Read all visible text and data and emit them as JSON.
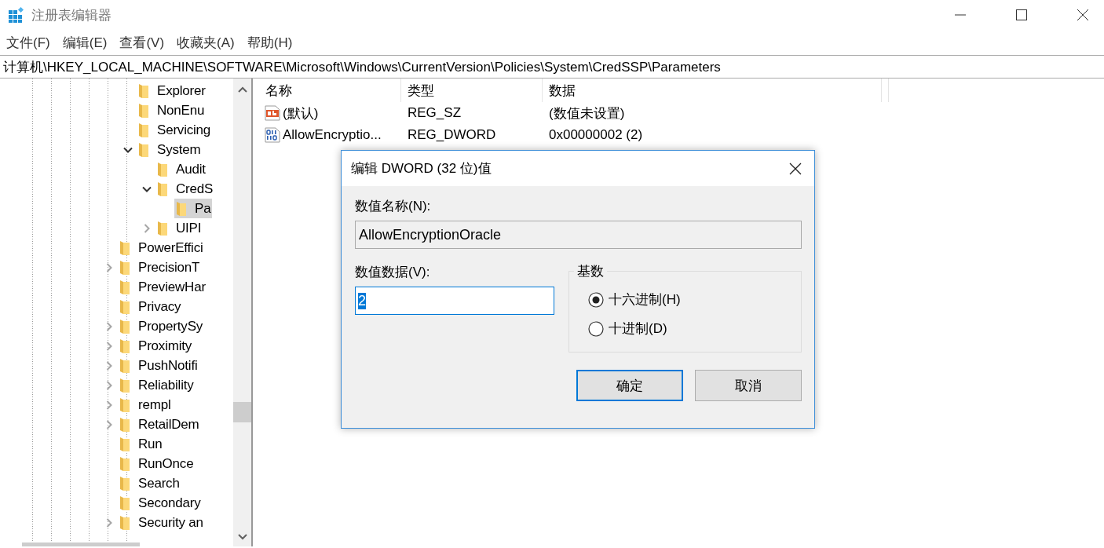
{
  "window": {
    "title": "注册表编辑器"
  },
  "menu": [
    "文件(F)",
    "编辑(E)",
    "查看(V)",
    "收藏夹(A)",
    "帮助(H)"
  ],
  "address": "计算机\\HKEY_LOCAL_MACHINE\\SOFTWARE\\Microsoft\\Windows\\CurrentVersion\\Policies\\System\\CredSSP\\Parameters",
  "tree": [
    {
      "children": [
        {
          "label": "Explorer",
          "selected": false
        },
        {
          "label": "NonEnu",
          "selected": false
        },
        {
          "label": "Servicing",
          "selected": false
        },
        {
          "label": "System",
          "expanded": true,
          "selected": false,
          "children": [
            {
              "label": "Audit",
              "selected": false
            },
            {
              "label": "CredS",
              "expanded": true,
              "selected": false,
              "children": [
                {
                  "label": "Pa",
                  "selected": true
                }
              ]
            },
            {
              "label": "UIPI",
              "expanded": false,
              "selected": false
            }
          ]
        }
      ]
    },
    {
      "label": "PowerEffici",
      "selected": false
    },
    {
      "label": "PrecisionT",
      "expanded": false,
      "selected": false
    },
    {
      "label": "PreviewHar",
      "selected": false
    },
    {
      "label": "Privacy",
      "selected": false
    },
    {
      "label": "PropertySy",
      "expanded": false,
      "selected": false
    },
    {
      "label": "Proximity",
      "expanded": false,
      "selected": false
    },
    {
      "label": "PushNotifi",
      "expanded": false,
      "selected": false
    },
    {
      "label": "Reliability",
      "expanded": false,
      "selected": false
    },
    {
      "label": "rempl",
      "expanded": false,
      "selected": false
    },
    {
      "label": "RetailDem",
      "expanded": false,
      "selected": false
    },
    {
      "label": "Run",
      "selected": false
    },
    {
      "label": "RunOnce",
      "selected": false
    },
    {
      "label": "Search",
      "selected": false
    },
    {
      "label": "Secondary",
      "selected": false
    },
    {
      "label": "Security an",
      "expanded": false,
      "selected": false
    }
  ],
  "list": {
    "columns": [
      "名称",
      "类型",
      "数据"
    ],
    "rows": [
      {
        "kind": "string",
        "name": "(默认)",
        "type": "REG_SZ",
        "data": "(数值未设置)"
      },
      {
        "kind": "binary",
        "name": "AllowEncryptio...",
        "type": "REG_DWORD",
        "data": "0x00000002 (2)"
      }
    ]
  },
  "dialog": {
    "title": "编辑 DWORD (32 位)值",
    "name_label": "数值名称(N):",
    "name_value": "AllowEncryptionOracle",
    "data_label": "数值数据(V):",
    "data_value": "2",
    "data_selected": true,
    "base": {
      "title": "基数",
      "options": [
        {
          "label": "十六进制(H)",
          "selected": true
        },
        {
          "label": "十进制(D)",
          "selected": false
        }
      ]
    },
    "buttons": [
      {
        "label": "确定",
        "default": true
      },
      {
        "label": "取消",
        "default": false
      }
    ]
  }
}
